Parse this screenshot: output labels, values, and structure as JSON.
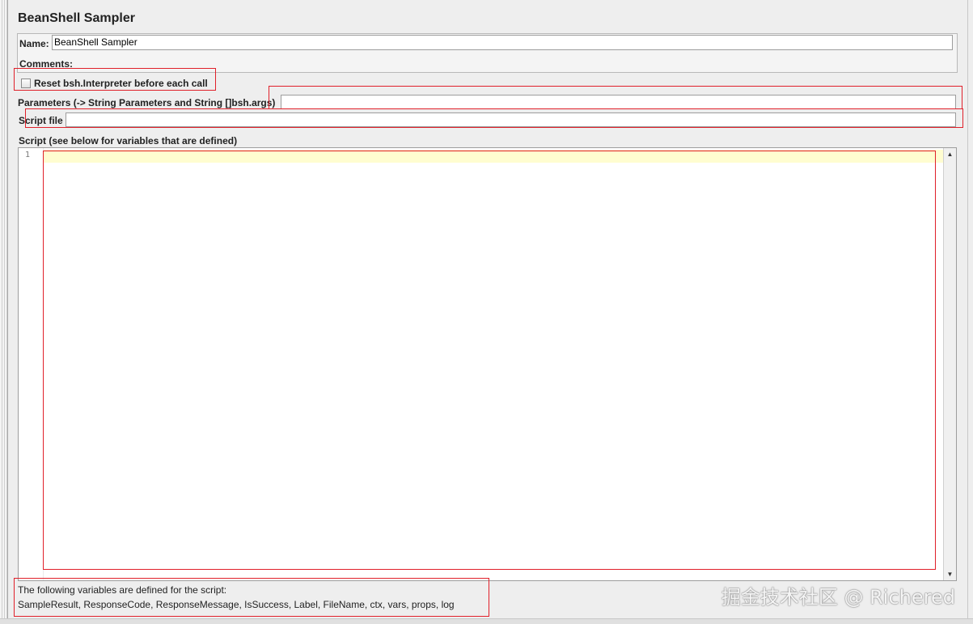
{
  "panel": {
    "title": "BeanShell Sampler"
  },
  "name_field": {
    "label": "Name:",
    "value": "BeanShell Sampler"
  },
  "comments": {
    "label": "Comments:"
  },
  "reset_checkbox": {
    "label": "Reset bsh.Interpreter before each call",
    "checked": false
  },
  "parameters": {
    "label": "Parameters (-> String Parameters and String []bsh.args)",
    "value": ""
  },
  "script_file": {
    "label": "Script file",
    "value": ""
  },
  "script": {
    "label": "Script (see below for variables that are defined)",
    "line_numbers": [
      "1"
    ]
  },
  "help": {
    "line1": "The following variables are defined for the script:",
    "line2": "SampleResult, ResponseCode, ResponseMessage, IsSuccess, Label, FileName, ctx, vars, props, log"
  },
  "watermark": "掘金技术社区 @ Richered",
  "colors": {
    "highlight_outline": "#e0202a",
    "current_line": "#fffdd0",
    "background": "#eeeeee"
  }
}
